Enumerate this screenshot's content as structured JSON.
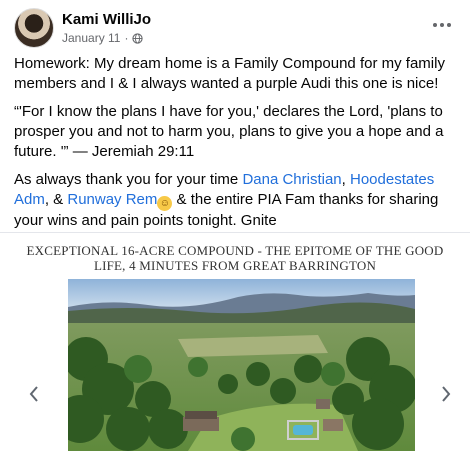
{
  "post": {
    "author": "Kami WilliJo",
    "date": "January 11",
    "dot": "·",
    "more_icon": "more-horizontal-icon",
    "privacy_icon": "globe-icon"
  },
  "body": {
    "p1": "Homework: My dream home is a Family Compound for my family members and I & I always wanted a purple Audi this one is nice!",
    "p2": "“'For I know the plans I have for you,' declares the Lord, 'plans to prosper you and not to harm you, plans to give you a hope and a future. '” — Jeremiah 29:11",
    "p3_start": "As always thank you for your time ",
    "mention1": "Dana Christian",
    "sep1": ", ",
    "mention2": "Hoodestates Adm",
    "sep2": ", & ",
    "mention3": "Runway Rem",
    "emoji": "☺",
    "p3_end": " & the entire PIA Fam thanks for sharing your wins and pain points tonight. Gnite"
  },
  "carousel": {
    "slide_title": "EXCEPTIONAL 16-ACRE COMPOUND - THE EPITOME OF THE GOOD LIFE, 4 MINUTES FROM GREAT BARRINGTON",
    "prev": "‹",
    "next": "›"
  }
}
